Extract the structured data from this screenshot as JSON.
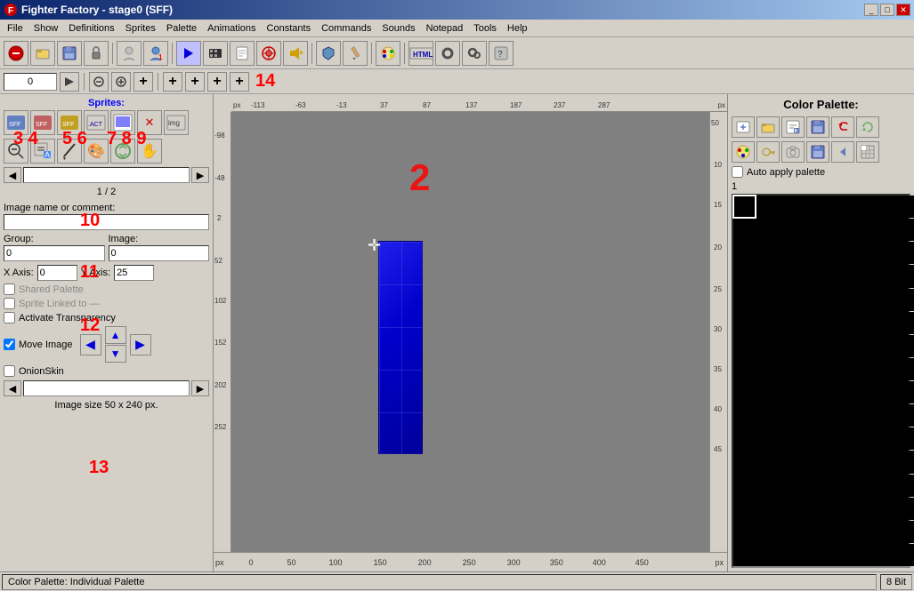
{
  "titlebar": {
    "title": "Fighter Factory - stage0 (SFF)",
    "min_label": "_",
    "max_label": "□",
    "close_label": "✕"
  },
  "menubar": {
    "items": [
      "File",
      "Show",
      "Definitions",
      "Sprites",
      "Palette",
      "Animations",
      "Constants",
      "Commands",
      "Sounds",
      "Notepad",
      "Tools",
      "Help"
    ]
  },
  "toolbar": {
    "buttons": [
      "🚫",
      "📁",
      "💾",
      "🔒",
      "👤",
      "👤",
      "▶",
      "🎬",
      "📄",
      "🎯",
      "🔊",
      "🛡️",
      "✏️",
      "🎨",
      "⚙️",
      "🔧",
      "💠"
    ]
  },
  "toolbar2": {
    "input_value": "0",
    "buttons_zoom": [
      "🔍",
      "🔍",
      "➕"
    ],
    "buttons_nav": [
      "➕",
      "➕",
      "➕",
      "➕"
    ],
    "label_14": "14"
  },
  "left_panel": {
    "sprites_title": "Sprites:",
    "sprite_icon_labels": [
      "3",
      "4",
      "5",
      "6",
      "7",
      "8",
      "9"
    ],
    "nav_prev": "◀",
    "nav_next": "▶",
    "page_text": "1 / 2",
    "image_name_label": "Image name or comment:",
    "group_label": "Group:",
    "image_label": "Image:",
    "group_value": "0",
    "image_value": "0",
    "xaxis_label": "X Axis:",
    "xaxis_value": "0",
    "yaxis_label": "Y Axis:",
    "yaxis_value": "25",
    "shared_palette_label": "Shared Palette",
    "sprite_linked_label": "Sprite Linked to —",
    "activate_transparency_label": "Activate Transparency",
    "move_image_label": "Move Image",
    "onion_skin_label": "OnionSkin",
    "image_size_label": "Image size 50 x 240 px.",
    "label_10": "10",
    "label_11": "11",
    "label_12": "12",
    "label_13": "13"
  },
  "canvas": {
    "ruler_h_ticks": [
      "-113",
      "-63",
      "-13",
      "37",
      "87",
      "137",
      "187",
      "237",
      "287"
    ],
    "ruler_v_ticks": [
      "-98",
      "-48",
      "2",
      "52",
      "102",
      "152",
      "202",
      "252"
    ],
    "ruler_right_ticks": [
      "50",
      "10",
      "15",
      "20",
      "25",
      "30",
      "35",
      "40",
      "45"
    ],
    "bottom_ticks": [
      "0",
      "50",
      "100",
      "150",
      "200",
      "250",
      "300",
      "350",
      "400",
      "450"
    ],
    "label_2": "2",
    "px_left": "px",
    "px_right": "px",
    "px_bottom_left": "px",
    "px_bottom_right": "px"
  },
  "right_panel": {
    "title": "Color Palette:",
    "palette_btns": [
      "📄",
      "📁",
      "✏️",
      "💾",
      "↩️",
      "🔄",
      "🎨",
      "🔑",
      "📷",
      "💾",
      "⬅",
      "🔲"
    ],
    "auto_apply_label": "Auto apply palette",
    "palette_index_label": "1"
  },
  "statusbar": {
    "color_palette_label": "Color Palette: Individual Palette",
    "bit_label": "8 Bit"
  }
}
